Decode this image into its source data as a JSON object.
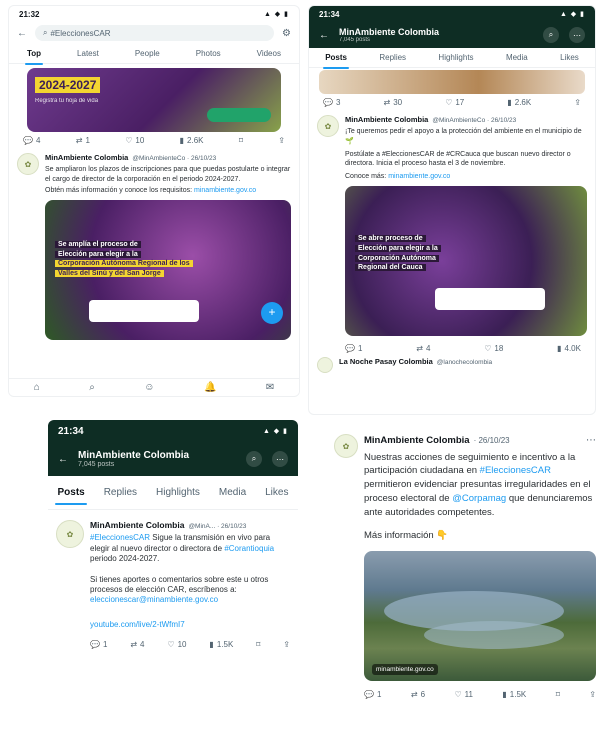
{
  "p1": {
    "status": {
      "time": "21:32",
      "sys": "▲ ◆ ▮"
    },
    "search": {
      "query": "#EleccionesCAR"
    },
    "tabs": [
      "Top",
      "Latest",
      "People",
      "Photos",
      "Videos"
    ],
    "banner": {
      "year": "2024-2027",
      "sub": "Registra tu hoja de vida"
    },
    "actions1": [
      "4",
      "1",
      "10",
      "2.6K"
    ],
    "post": {
      "name": "MinAmbiente Colombia",
      "handle": "@MinAmbienteCo · 26/10/23",
      "text": "Se ampliaron los plazos de inscripciones para que puedas postularte o integrar el cargo de director de la corporación en el periodo 2024-2027.",
      "text2": "Obtén más información y conoce los requisitos:",
      "link": "minambiente.gov.co",
      "media": {
        "line1": "Se amplía el proceso de",
        "line2": "Elección para elegir a la",
        "line3": "Corporación Autónoma Regional de los",
        "line4": "Valles del Sinú y del San Jorge"
      }
    }
  },
  "p2": {
    "status": {
      "time": "21:34",
      "sys": "▲ ◆ ▮"
    },
    "header": {
      "title": "MinAmbiente Colombia",
      "sub": "7,045 posts"
    },
    "tabs": [
      "Posts",
      "Replies",
      "Highlights",
      "Media",
      "Likes"
    ],
    "actions1": [
      "3",
      "30",
      "17",
      "2.6K"
    ],
    "post": {
      "name": "MinAmbiente Colombia",
      "handle": "@MinAmbienteCo · 26/10/23",
      "text": "¡Te queremos pedir el apoyo a la protección del ambiente en el municipio de 🌱",
      "text2": "Postúlate a #EleccionesCAR de #CRCauca que buscan nuevo director o directora. Inicia el proceso hasta el 3 de noviembre.",
      "text3": "Conoce más:",
      "link": "minambiente.gov.co",
      "media": {
        "line1": "Se abre proceso de",
        "line2": "Elección para elegir a la",
        "line3": "Corporación Autónoma",
        "line4": "Regional del Cauca"
      }
    },
    "actions2": [
      "1",
      "4",
      "18",
      "4.0K"
    ],
    "post2": {
      "name": "La Noche Pasay Colombia",
      "handle": "@lanochecolombia"
    }
  },
  "p3": {
    "status": {
      "time": "21:34",
      "sys": "▲ ◆ ▮"
    },
    "header": {
      "title": "MinAmbiente Colombia",
      "sub": "7,045 posts"
    },
    "tabs": [
      "Posts",
      "Replies",
      "Highlights",
      "Media",
      "Likes"
    ],
    "post": {
      "name": "MinAmbiente Colombia",
      "handle": "@MinA... · 26/10/23",
      "hashtag": "#EleccionesCAR",
      "text": "Sigue la transmisión en vivo para elegir al nuevo director o directora de",
      "hashtag2": "#Corantioquia",
      "text_b": "periodo 2024-2027.",
      "text2": "Si tienes aportes o comentarios sobre este u otros procesos de elección CAR, escríbenos a:",
      "email": "eleccionescar@minambiente.gov.co",
      "link": "youtube.com/live/2-tWfmI7"
    },
    "actions": [
      "1",
      "4",
      "10",
      "1.5K"
    ]
  },
  "p4": {
    "post": {
      "name": "MinAmbiente Colombia",
      "handle": "· 26/10/23",
      "text_a": "Nuestras acciones de seguimiento e incentivo a la participación ciudadana en",
      "hashtag": "#EleccionesCAR",
      "text_b": "permitieron evidenciar presuntas irregularidades en el proceso electoral de",
      "hashtag2": "@Corpamag",
      "text_c": "que denunciaremos ante autoridades competentes.",
      "more": "Más información 👇",
      "image_caption": "minambiente.gov.co"
    },
    "actions": [
      "1",
      "6",
      "11",
      "1.5K"
    ]
  }
}
